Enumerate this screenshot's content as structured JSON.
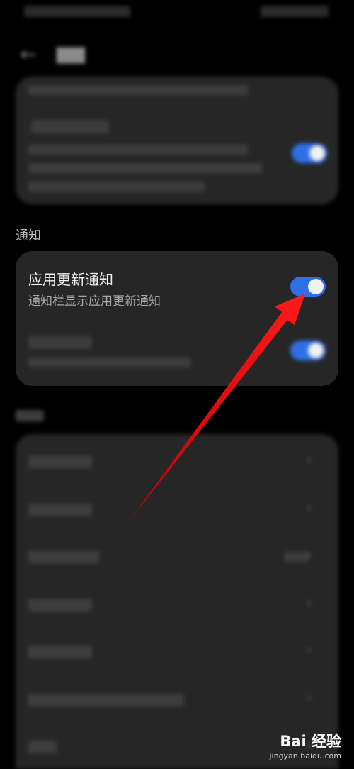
{
  "notify_section": {
    "label": "通知",
    "app_update": {
      "title": "应用更新通知",
      "subtitle": "通知栏显示应用更新通知",
      "toggle_on": true
    }
  },
  "colors": {
    "background": "#000000",
    "card": "#262626",
    "toggle_on": "#2f6fe6",
    "arrow": "#ff0000"
  },
  "watermark": {
    "logo": "Bai 经验",
    "site": "jingyan.baidu.com"
  }
}
